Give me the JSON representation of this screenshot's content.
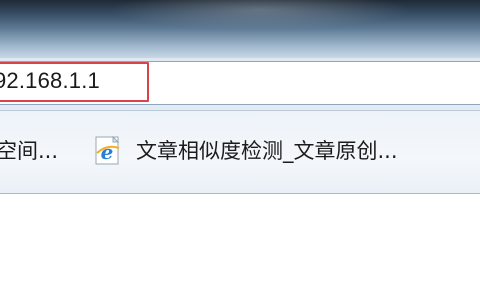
{
  "address_bar": {
    "url": "92.168.1.1"
  },
  "favorites_bar": {
    "items": [
      {
        "label": "空间...",
        "icon": "none"
      },
      {
        "label": "文章相似度检测_文章原创...",
        "icon": "ie-icon"
      }
    ]
  },
  "colors": {
    "highlight_border": "#d9434a",
    "ie_blue": "#2a7fd4",
    "ie_ring": "#f2b01e"
  }
}
